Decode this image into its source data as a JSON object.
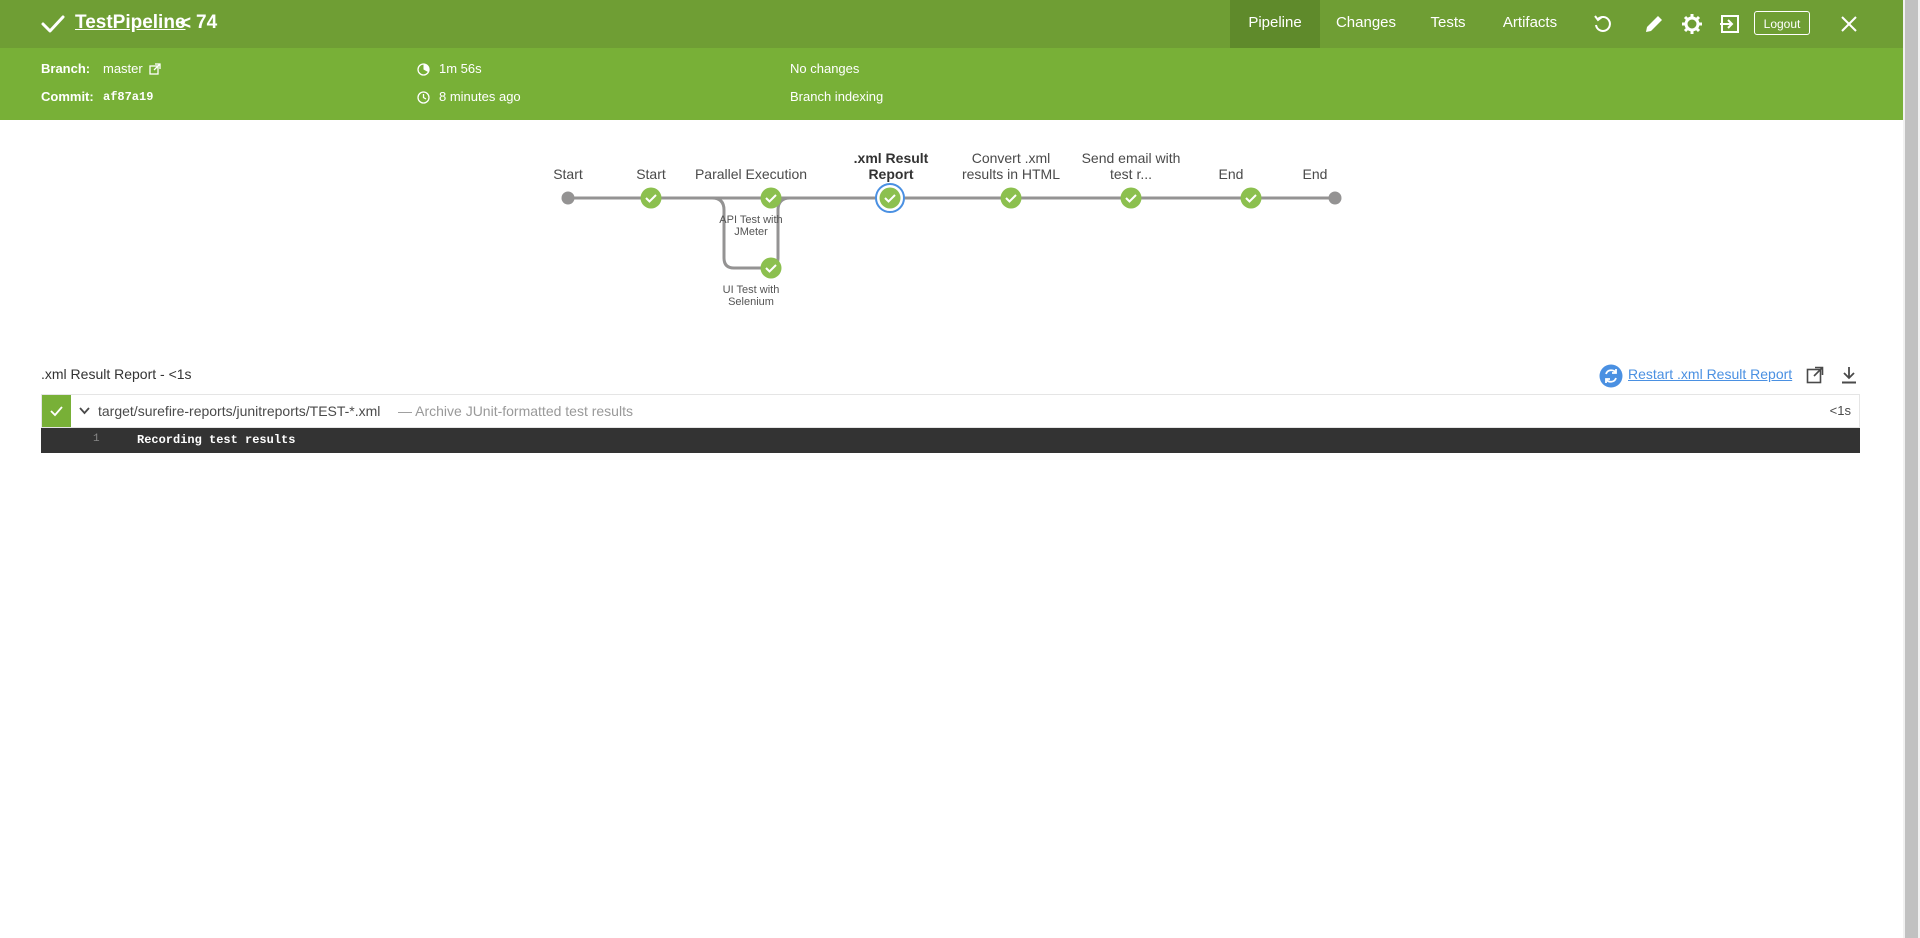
{
  "header": {
    "pipeline_name": "TestPipeline",
    "chevron": "<",
    "run_number": "74",
    "status_icon": "check-icon",
    "tabs": [
      {
        "label": "Pipeline",
        "active": true
      },
      {
        "label": "Changes",
        "active": false
      },
      {
        "label": "Tests",
        "active": false
      },
      {
        "label": "Artifacts",
        "active": false
      }
    ],
    "logout_label": "Logout",
    "icons": [
      "replay-icon",
      "edit-icon",
      "gear-icon",
      "exit-icon",
      "close-icon"
    ]
  },
  "meta": {
    "branch_label": "Branch:",
    "branch_value": "master",
    "commit_label": "Commit:",
    "commit_value": "af87a19",
    "duration": "1m 56s",
    "started": "8 minutes ago",
    "changes": "No changes",
    "cause": "Branch indexing"
  },
  "graph": {
    "stages": [
      {
        "label": "Start",
        "status": "none"
      },
      {
        "label": "Start",
        "status": "success"
      },
      {
        "label": "Parallel Execution",
        "status": "success",
        "branches": [
          "API Test with JMeter",
          "UI Test with Selenium"
        ]
      },
      {
        "label": ".xml Result Report",
        "status": "success",
        "selected": true
      },
      {
        "label": "Convert .xml results in HTML",
        "status": "success"
      },
      {
        "label": "Send email with test r...",
        "status": "success"
      },
      {
        "label": "End",
        "status": "success"
      },
      {
        "label": "End",
        "status": "none"
      }
    ],
    "label_lines": {
      "start1": "Start",
      "start2": "Start",
      "parallel": "Parallel Execution",
      "xml_l1": ".xml Result",
      "xml_l2": "Report",
      "convert_l1": "Convert .xml",
      "convert_l2": "results in HTML",
      "email_l1": "Send email with",
      "email_l2": "test r...",
      "end1": "End",
      "end2": "End",
      "api_l1": "API Test with",
      "api_l2": "JMeter",
      "ui_l1": "UI Test with",
      "ui_l2": "Selenium"
    }
  },
  "step_detail": {
    "title": ".xml Result Report - <1s",
    "restart_label": "Restart .xml Result Report",
    "rows": [
      {
        "status": "success",
        "path": "target/surefire-reports/junitreports/TEST-*.xml",
        "description": "— Archive JUnit-formatted test results",
        "duration": "<1s"
      }
    ],
    "log": [
      {
        "line": "1",
        "text": "Recording test results"
      }
    ]
  },
  "colors": {
    "topbar": "#6f9e34",
    "subbar": "#78b037",
    "success": "#8cc04f",
    "selected_ring": "#4a90e2",
    "console_bg": "#333333"
  }
}
